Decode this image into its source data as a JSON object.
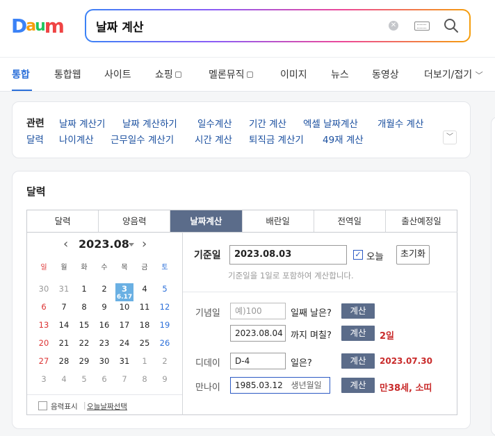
{
  "logo": {
    "letters": [
      "D",
      "a",
      "u",
      "m"
    ],
    "colors": [
      "#3b82f6",
      "#f59e0b",
      "#22c55e",
      "#ef4444"
    ]
  },
  "search": {
    "query": "날짜 계산"
  },
  "nav_tabs": [
    "통합",
    "통합웹",
    "사이트",
    "쇼핑",
    "멜론뮤직",
    "이미지",
    "뉴스",
    "동영상",
    "더보기/접기"
  ],
  "related": {
    "title": "관련",
    "links": [
      "날짜 계산기",
      "날짜 계산하기",
      "일수계산",
      "기간 계산",
      "엑셀 날짜계산",
      "개월수 계산",
      "달력",
      "나이계산",
      "근무일수 계산기",
      "시간 계산",
      "퇴직금 계산기",
      "49재 계산"
    ]
  },
  "calc": {
    "title": "달력",
    "tabs": [
      "달력",
      "양음력",
      "날짜계산",
      "배란일",
      "전역일",
      "출산예정일"
    ],
    "calendar": {
      "month": "2023.08",
      "dow": [
        "일",
        "월",
        "화",
        "수",
        "목",
        "금",
        "토"
      ],
      "weeks": [
        [
          "30",
          "31",
          "1",
          "2",
          "3",
          "4",
          "5"
        ],
        [
          "6",
          "7",
          "8",
          "9",
          "10",
          "11",
          "12"
        ],
        [
          "13",
          "14",
          "15",
          "16",
          "17",
          "18",
          "19"
        ],
        [
          "20",
          "21",
          "22",
          "23",
          "24",
          "25",
          "26"
        ],
        [
          "27",
          "28",
          "29",
          "30",
          "31",
          "1",
          "2"
        ],
        [
          "3",
          "4",
          "5",
          "6",
          "7",
          "8",
          "9"
        ]
      ],
      "lunar_today": "6.17",
      "show_lunar_label": "음력표시",
      "select_today_label": "오늘날짜선택"
    },
    "base": {
      "label": "기준일",
      "value": "2023.08.03",
      "today_label": "오늘",
      "reset_label": "초기화",
      "note": "기준일을 1일로 포함하여 계산합니다."
    },
    "anniversary": {
      "label": "기념일",
      "placeholder": "예)100",
      "suffix": "일째 날은?",
      "date_value": "2023.08.04",
      "date_suffix": "까지 며칠?",
      "date_result": "2일"
    },
    "dday": {
      "label": "디데이",
      "value": "D-4",
      "suffix": "일은?",
      "result": "2023.07.30"
    },
    "age": {
      "label": "만나이",
      "value": "1985.03.12",
      "placeholder_hint": "생년월일",
      "result": "만38세, 소띠"
    },
    "calc_button": "계산"
  }
}
